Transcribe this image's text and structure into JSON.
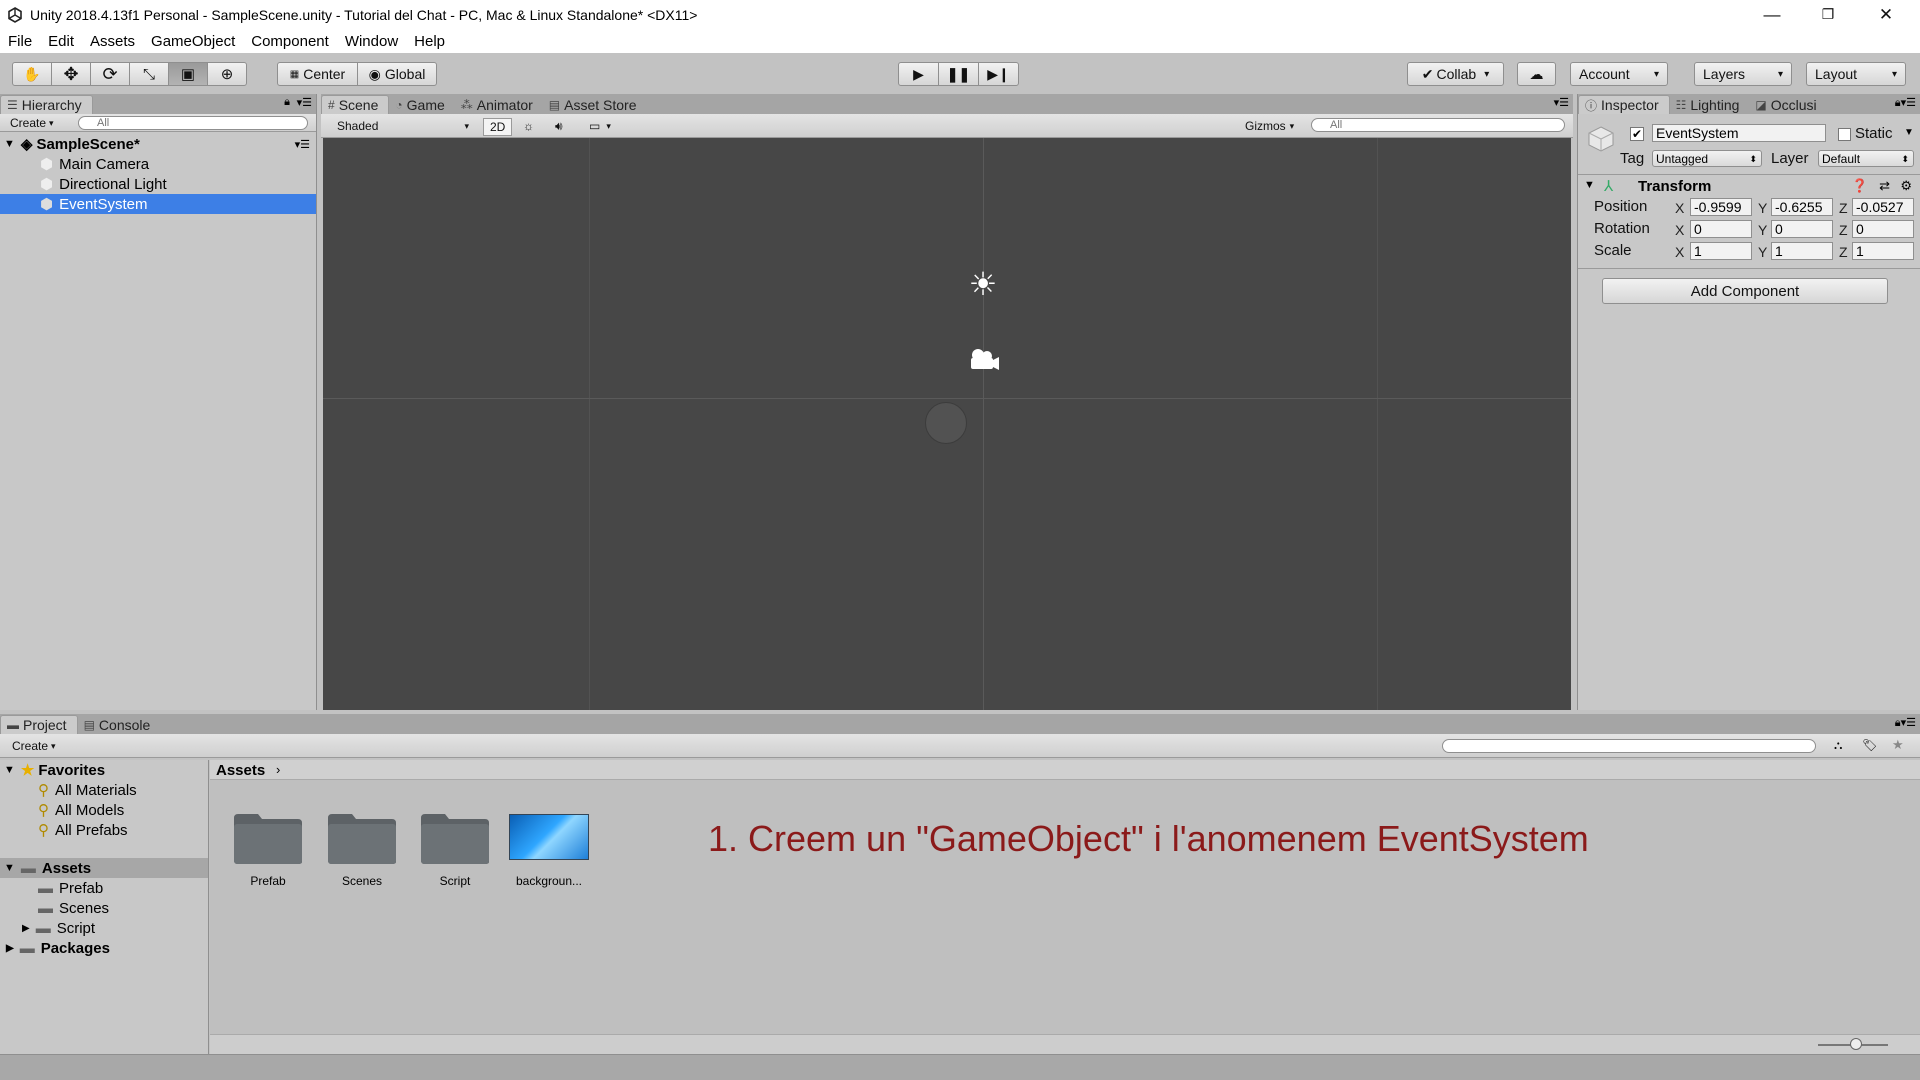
{
  "window": {
    "title": "Unity 2018.4.13f1 Personal - SampleScene.unity - Tutorial del Chat - PC, Mac & Linux Standalone* <DX11>",
    "controls": [
      "—",
      "❐",
      "✕"
    ]
  },
  "menubar": {
    "items": [
      "File",
      "Edit",
      "Assets",
      "GameObject",
      "Component",
      "Window",
      "Help"
    ]
  },
  "toolbar": {
    "pivot": "Center",
    "space": "Global",
    "collab": "Collab",
    "account": "Account",
    "layers": "Layers",
    "layout": "Layout"
  },
  "hierarchy": {
    "tab": "Hierarchy",
    "create": "Create",
    "search_placeholder": "All",
    "scene": "SampleScene*",
    "items": [
      "Main Camera",
      "Directional Light",
      "EventSystem"
    ],
    "selected": "EventSystem"
  },
  "scene_view": {
    "tabs": [
      "Scene",
      "Game",
      "Animator",
      "Asset Store"
    ],
    "shading": "Shaded",
    "mode_2d": "2D",
    "gizmos": "Gizmos",
    "search_placeholder": "All"
  },
  "inspector": {
    "tabs": [
      "Inspector",
      "Lighting",
      "Occlusi"
    ],
    "object_name": "EventSystem",
    "static_label": "Static",
    "tag_label": "Tag",
    "tag_value": "Untagged",
    "layer_label": "Layer",
    "layer_value": "Default",
    "component": "Transform",
    "position_label": "Position",
    "rotation_label": "Rotation",
    "scale_label": "Scale",
    "position": {
      "x": "-0.9599",
      "y": "-0.6255",
      "z": "-0.0527"
    },
    "rotation": {
      "x": "0",
      "y": "0",
      "z": "0"
    },
    "scale": {
      "x": "1",
      "y": "1",
      "z": "1"
    },
    "add_component": "Add Component"
  },
  "project": {
    "tabs": [
      "Project",
      "Console"
    ],
    "create": "Create",
    "favorites": "Favorites",
    "favorite_items": [
      "All Materials",
      "All Models",
      "All Prefabs"
    ],
    "assets_root": "Assets",
    "asset_folders": [
      "Prefab",
      "Scenes",
      "Script"
    ],
    "packages": "Packages",
    "breadcrumb": "Assets",
    "grid_items": [
      "Prefab",
      "Scenes",
      "Script",
      "backgroun..."
    ],
    "annotation": "1. Creem un \"GameObject\" i l'anomenem EventSystem"
  },
  "colors": {
    "selection": "#3d7fe6",
    "scene_bg": "#474747",
    "annotation": "#8b1a1a"
  }
}
